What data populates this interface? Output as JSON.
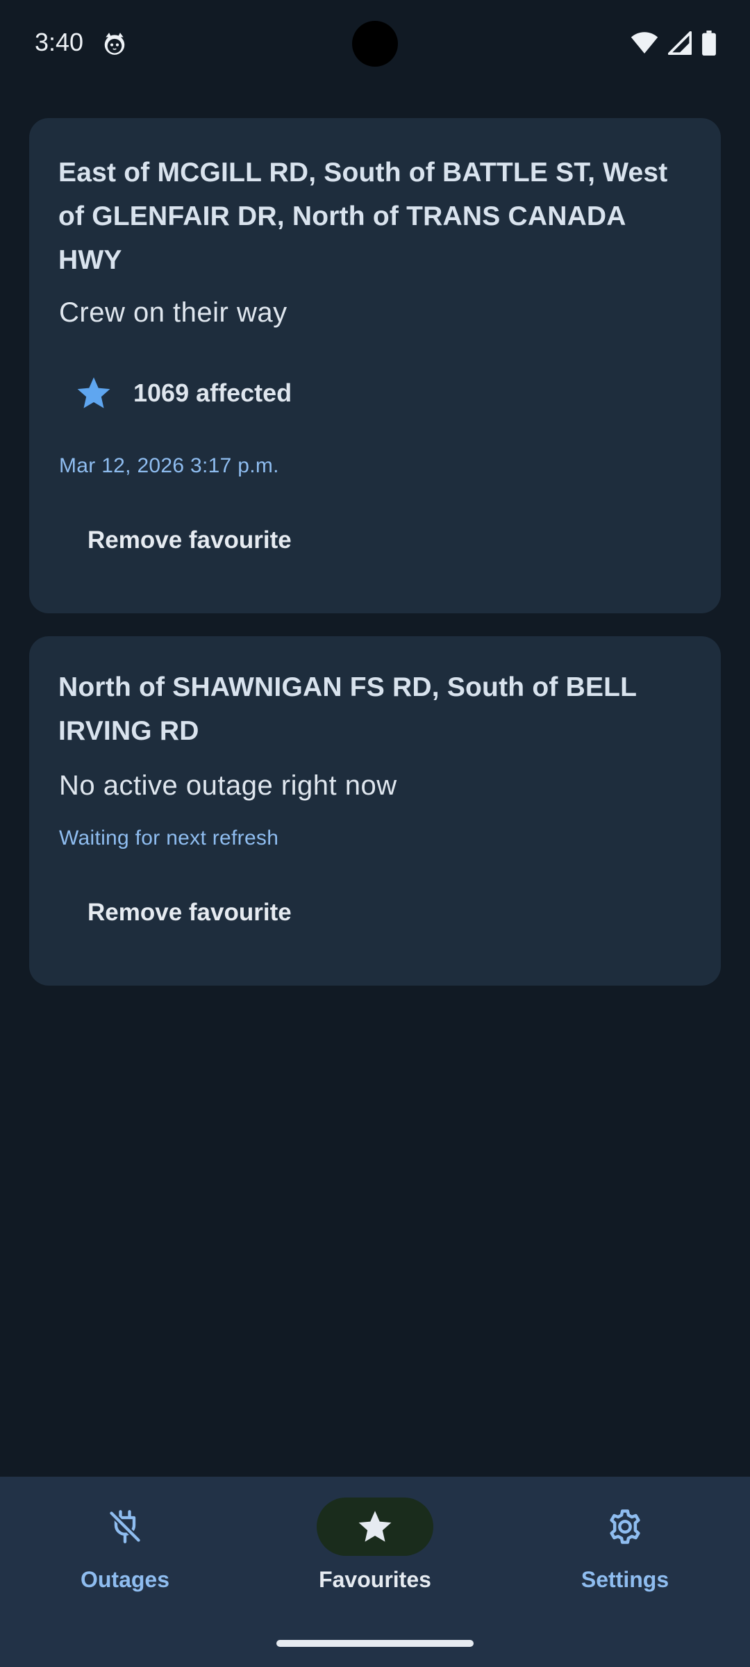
{
  "status_bar": {
    "time": "3:40",
    "icons": [
      "cat-notification-icon",
      "wifi-icon",
      "signal-icon",
      "battery-icon"
    ]
  },
  "favourites": [
    {
      "title": "East of MCGILL RD, South of BATTLE ST, West of GLENFAIR DR, North of TRANS CANADA HWY",
      "status": "Crew on their way",
      "affected": "1069 affected",
      "timestamp": "Mar 12, 2026 3:17 p.m.",
      "remove_label": "Remove favourite"
    },
    {
      "title": "North of SHAWNIGAN FS RD, South of BELL IRVING RD",
      "status": "No active outage right now",
      "note": "Waiting for next refresh",
      "remove_label": "Remove favourite"
    }
  ],
  "bottom_nav": {
    "items": [
      {
        "label": "Outages",
        "icon": "power-off-icon",
        "active": false
      },
      {
        "label": "Favourites",
        "icon": "star-icon",
        "active": true
      },
      {
        "label": "Settings",
        "icon": "gear-icon",
        "active": false
      }
    ]
  },
  "colors": {
    "background": "#111a24",
    "card": "#1e2d3d",
    "accent": "#8fbdf0",
    "star": "#5fa6f0",
    "nav_background": "#223247",
    "nav_active_pill": "#1a2c1c"
  }
}
